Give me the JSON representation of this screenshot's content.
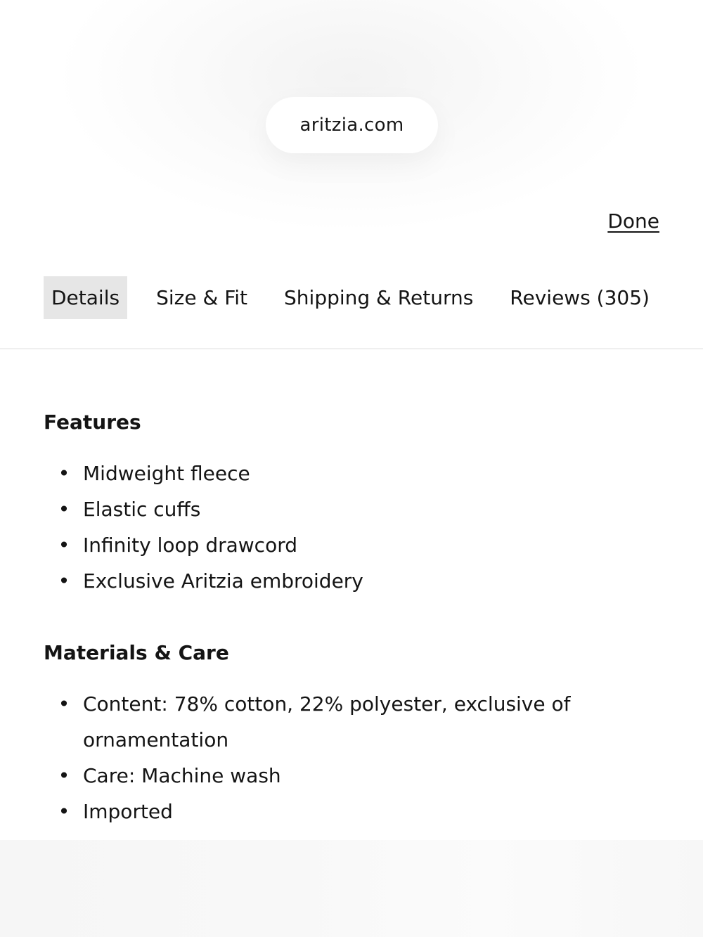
{
  "browser": {
    "url": "aritzia.com"
  },
  "header": {
    "done_label": "Done"
  },
  "tabs": [
    {
      "label": "Details",
      "active": true
    },
    {
      "label": "Size & Fit",
      "active": false
    },
    {
      "label": "Shipping & Returns",
      "active": false
    },
    {
      "label": "Reviews (305)",
      "active": false
    }
  ],
  "features": {
    "title": "Features",
    "items": [
      "Midweight fleece",
      "Elastic cuffs",
      "Infinity loop drawcord",
      "Exclusive Aritzia embroidery"
    ]
  },
  "materials": {
    "title": "Materials & Care",
    "items": [
      "Content: 78% cotton, 22% polyester, exclusive of ornamentation",
      "Care: Machine wash",
      "Imported"
    ]
  },
  "bullet_glyph": "•",
  "colors": {
    "text": "#141414",
    "active_tab_bg": "#e6e6e6",
    "divider": "#efefef"
  }
}
